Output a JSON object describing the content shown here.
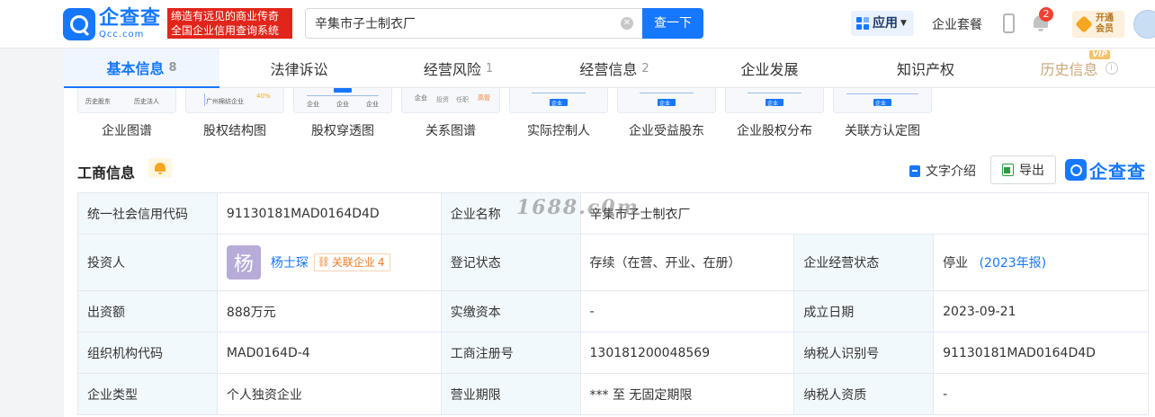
{
  "header": {
    "logo_cn": "企查查",
    "logo_en": "Qcc.com",
    "slogan_line1": "缔造有远见的商业传奇",
    "slogan_line2": "全国企业信用查询系统",
    "search_value": "辛集市子士制衣厂",
    "search_button": "查一下",
    "apps_label": "应用",
    "suite_label": "企业套餐",
    "notification_count": "2",
    "vip_label": "开通会员"
  },
  "tabs": [
    {
      "label": "基本信息",
      "count": "8"
    },
    {
      "label": "法律诉讼",
      "count": ""
    },
    {
      "label": "经营风险",
      "count": "1"
    },
    {
      "label": "经营信息",
      "count": "2"
    },
    {
      "label": "企业发展",
      "count": ""
    },
    {
      "label": "知识产权",
      "count": ""
    },
    {
      "label": "历史信息",
      "count": "",
      "vip_tag": "VIP"
    }
  ],
  "diagrams": {
    "items": [
      {
        "label": "企业图谱"
      },
      {
        "label": "股权结构图"
      },
      {
        "label": "股权穿透图"
      },
      {
        "label": "关系图谱"
      },
      {
        "label": "实际控制人"
      },
      {
        "label": "企业受益股东"
      },
      {
        "label": "企业股权分布"
      },
      {
        "label": "关联方认定图"
      }
    ],
    "mini": {
      "d1a": "历史股东",
      "d1b": "历史法人",
      "d2a": "广州棉纺企业",
      "d2b": "40%",
      "d3": "企业",
      "d4a": "企业",
      "d4b": "投资",
      "d4c": "任职",
      "d4d": "高管",
      "d5": "企业"
    }
  },
  "section": {
    "title": "工商信息",
    "text_intro": "文字介绍",
    "export": "导出",
    "brand": "企查查"
  },
  "info": {
    "r1": {
      "k1": "统一社会信用代码",
      "v1": "91130181MAD0164D4D",
      "k2": "企业名称",
      "v2": "辛集市子士制衣厂"
    },
    "r2": {
      "k1": "投资人",
      "avatar_char": "杨",
      "investor_name": "杨士琛",
      "related_label": "关联企业",
      "related_count": "4",
      "k2": "登记状态",
      "v2": "存续（在营、开业、在册）",
      "k3": "企业经营状态",
      "v3": "停业",
      "v3_link": "(2023年报)"
    },
    "r3": {
      "k1": "出资额",
      "v1": "888万元",
      "k2": "实缴资本",
      "v2": "-",
      "k3": "成立日期",
      "v3": "2023-09-21"
    },
    "r4": {
      "k1": "组织机构代码",
      "v1": "MAD0164D-4",
      "k2": "工商注册号",
      "v2": "130181200048569",
      "k3": "纳税人识别号",
      "v3": "91130181MAD0164D4D"
    },
    "r5": {
      "k1": "企业类型",
      "v1": "个人独资企业",
      "k2": "营业期限",
      "v2": "*** 至 无固定期限",
      "k3": "纳税人资质",
      "v3": "-"
    }
  },
  "watermark": "1688.c0m",
  "colors": {
    "accent": "#1677ff",
    "slogan_bg": "#e1251b",
    "key_cell_bg": "#f2f9fc",
    "history_tab": "#c9a77c"
  }
}
